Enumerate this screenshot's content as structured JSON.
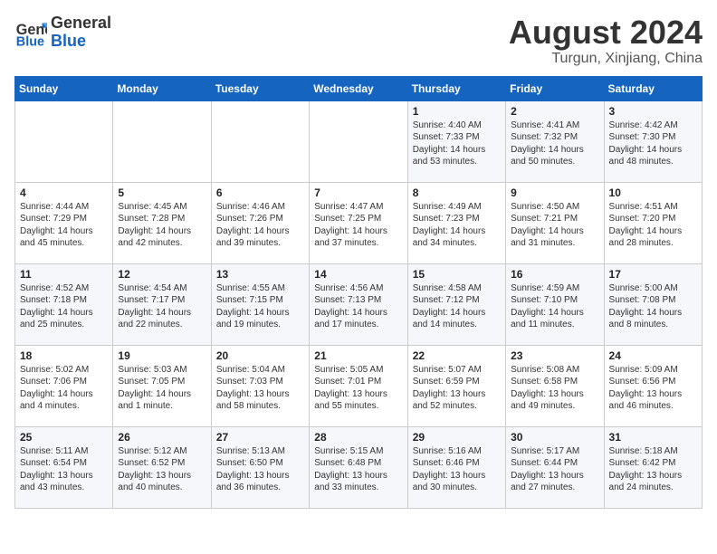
{
  "header": {
    "logo_line1": "General",
    "logo_line2": "Blue",
    "main_title": "August 2024",
    "subtitle": "Turgun, Xinjiang, China"
  },
  "days_of_week": [
    "Sunday",
    "Monday",
    "Tuesday",
    "Wednesday",
    "Thursday",
    "Friday",
    "Saturday"
  ],
  "weeks": [
    [
      {
        "day": "",
        "info": ""
      },
      {
        "day": "",
        "info": ""
      },
      {
        "day": "",
        "info": ""
      },
      {
        "day": "",
        "info": ""
      },
      {
        "day": "1",
        "info": "Sunrise: 4:40 AM\nSunset: 7:33 PM\nDaylight: 14 hours\nand 53 minutes."
      },
      {
        "day": "2",
        "info": "Sunrise: 4:41 AM\nSunset: 7:32 PM\nDaylight: 14 hours\nand 50 minutes."
      },
      {
        "day": "3",
        "info": "Sunrise: 4:42 AM\nSunset: 7:30 PM\nDaylight: 14 hours\nand 48 minutes."
      }
    ],
    [
      {
        "day": "4",
        "info": "Sunrise: 4:44 AM\nSunset: 7:29 PM\nDaylight: 14 hours\nand 45 minutes."
      },
      {
        "day": "5",
        "info": "Sunrise: 4:45 AM\nSunset: 7:28 PM\nDaylight: 14 hours\nand 42 minutes."
      },
      {
        "day": "6",
        "info": "Sunrise: 4:46 AM\nSunset: 7:26 PM\nDaylight: 14 hours\nand 39 minutes."
      },
      {
        "day": "7",
        "info": "Sunrise: 4:47 AM\nSunset: 7:25 PM\nDaylight: 14 hours\nand 37 minutes."
      },
      {
        "day": "8",
        "info": "Sunrise: 4:49 AM\nSunset: 7:23 PM\nDaylight: 14 hours\nand 34 minutes."
      },
      {
        "day": "9",
        "info": "Sunrise: 4:50 AM\nSunset: 7:21 PM\nDaylight: 14 hours\nand 31 minutes."
      },
      {
        "day": "10",
        "info": "Sunrise: 4:51 AM\nSunset: 7:20 PM\nDaylight: 14 hours\nand 28 minutes."
      }
    ],
    [
      {
        "day": "11",
        "info": "Sunrise: 4:52 AM\nSunset: 7:18 PM\nDaylight: 14 hours\nand 25 minutes."
      },
      {
        "day": "12",
        "info": "Sunrise: 4:54 AM\nSunset: 7:17 PM\nDaylight: 14 hours\nand 22 minutes."
      },
      {
        "day": "13",
        "info": "Sunrise: 4:55 AM\nSunset: 7:15 PM\nDaylight: 14 hours\nand 19 minutes."
      },
      {
        "day": "14",
        "info": "Sunrise: 4:56 AM\nSunset: 7:13 PM\nDaylight: 14 hours\nand 17 minutes."
      },
      {
        "day": "15",
        "info": "Sunrise: 4:58 AM\nSunset: 7:12 PM\nDaylight: 14 hours\nand 14 minutes."
      },
      {
        "day": "16",
        "info": "Sunrise: 4:59 AM\nSunset: 7:10 PM\nDaylight: 14 hours\nand 11 minutes."
      },
      {
        "day": "17",
        "info": "Sunrise: 5:00 AM\nSunset: 7:08 PM\nDaylight: 14 hours\nand 8 minutes."
      }
    ],
    [
      {
        "day": "18",
        "info": "Sunrise: 5:02 AM\nSunset: 7:06 PM\nDaylight: 14 hours\nand 4 minutes."
      },
      {
        "day": "19",
        "info": "Sunrise: 5:03 AM\nSunset: 7:05 PM\nDaylight: 14 hours\nand 1 minute."
      },
      {
        "day": "20",
        "info": "Sunrise: 5:04 AM\nSunset: 7:03 PM\nDaylight: 13 hours\nand 58 minutes."
      },
      {
        "day": "21",
        "info": "Sunrise: 5:05 AM\nSunset: 7:01 PM\nDaylight: 13 hours\nand 55 minutes."
      },
      {
        "day": "22",
        "info": "Sunrise: 5:07 AM\nSunset: 6:59 PM\nDaylight: 13 hours\nand 52 minutes."
      },
      {
        "day": "23",
        "info": "Sunrise: 5:08 AM\nSunset: 6:58 PM\nDaylight: 13 hours\nand 49 minutes."
      },
      {
        "day": "24",
        "info": "Sunrise: 5:09 AM\nSunset: 6:56 PM\nDaylight: 13 hours\nand 46 minutes."
      }
    ],
    [
      {
        "day": "25",
        "info": "Sunrise: 5:11 AM\nSunset: 6:54 PM\nDaylight: 13 hours\nand 43 minutes."
      },
      {
        "day": "26",
        "info": "Sunrise: 5:12 AM\nSunset: 6:52 PM\nDaylight: 13 hours\nand 40 minutes."
      },
      {
        "day": "27",
        "info": "Sunrise: 5:13 AM\nSunset: 6:50 PM\nDaylight: 13 hours\nand 36 minutes."
      },
      {
        "day": "28",
        "info": "Sunrise: 5:15 AM\nSunset: 6:48 PM\nDaylight: 13 hours\nand 33 minutes."
      },
      {
        "day": "29",
        "info": "Sunrise: 5:16 AM\nSunset: 6:46 PM\nDaylight: 13 hours\nand 30 minutes."
      },
      {
        "day": "30",
        "info": "Sunrise: 5:17 AM\nSunset: 6:44 PM\nDaylight: 13 hours\nand 27 minutes."
      },
      {
        "day": "31",
        "info": "Sunrise: 5:18 AM\nSunset: 6:42 PM\nDaylight: 13 hours\nand 24 minutes."
      }
    ]
  ]
}
